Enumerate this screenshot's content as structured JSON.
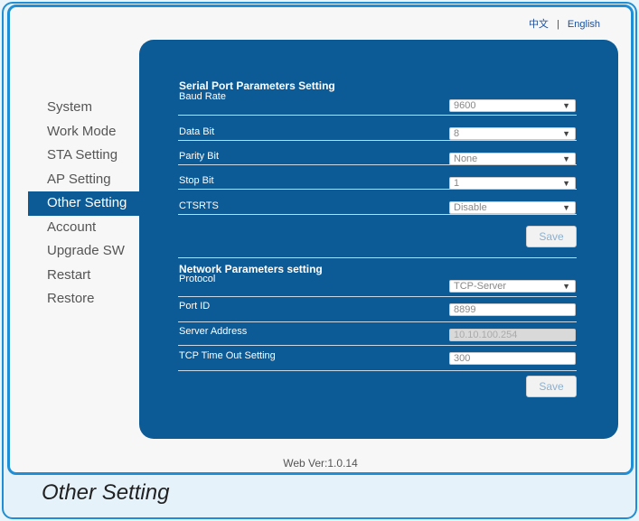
{
  "lang": {
    "chinese": "中文",
    "separator": "|",
    "english": "English"
  },
  "sidebar": {
    "items": [
      {
        "label": "System"
      },
      {
        "label": "Work Mode"
      },
      {
        "label": "STA Setting"
      },
      {
        "label": "AP Setting"
      },
      {
        "label": "Other Setting",
        "active": true
      },
      {
        "label": "Account"
      },
      {
        "label": "Upgrade SW"
      },
      {
        "label": "Restart"
      },
      {
        "label": "Restore"
      }
    ]
  },
  "serial": {
    "title": "Serial Port Parameters Setting",
    "baud_rate": {
      "label": "Baud Rate",
      "value": "9600"
    },
    "data_bit": {
      "label": "Data Bit",
      "value": "8"
    },
    "parity_bit": {
      "label": "Parity Bit",
      "value": "None"
    },
    "stop_bit": {
      "label": "Stop Bit",
      "value": "1"
    },
    "ctsrts": {
      "label": "CTSRTS",
      "value": "Disable"
    },
    "save_label": "Save"
  },
  "network": {
    "title": "Network Parameters setting",
    "protocol": {
      "label": "Protocol",
      "value": "TCP-Server"
    },
    "port_id": {
      "label": "Port ID",
      "value": "8899"
    },
    "server_address": {
      "label": "Server Address",
      "value": "10.10.100.254"
    },
    "tcp_timeout": {
      "label": "TCP Time Out Setting",
      "value": "300"
    },
    "save_label": "Save"
  },
  "footer": {
    "web_version": "Web Ver:1.0.14"
  },
  "caption": "Other Setting",
  "colors": {
    "accent": "#1e8fd6",
    "panel": "#0d5b96"
  }
}
